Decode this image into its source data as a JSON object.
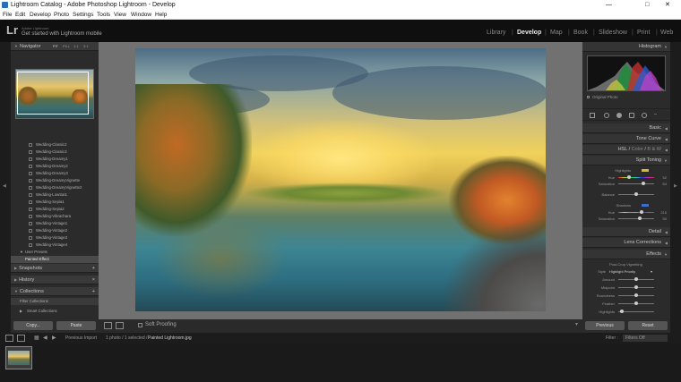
{
  "window": {
    "title": "Lightroom Catalog - Adobe Photoshop Lightroom - Develop"
  },
  "menu": [
    "File",
    "Edit",
    "Develop",
    "Photo",
    "Settings",
    "Tools",
    "View",
    "Window",
    "Help"
  ],
  "identity": {
    "logo": "Lr",
    "brand": "Adobe Lightroom",
    "mobile": "Get started with Lightroom mobile"
  },
  "modules": [
    "Library",
    "Develop",
    "Map",
    "Book",
    "Slideshow",
    "Print",
    "Web"
  ],
  "left": {
    "navigator": {
      "title": "Navigator",
      "zoom": [
        "FIT",
        "FILL",
        "1:1",
        "3:1"
      ]
    },
    "presets": [
      "Wedding-Classic2",
      "Wedding-Classic3",
      "Wedding-Dreamy1",
      "Wedding-Dreamy2",
      "Wedding-Dreamy3",
      "Wedding-DreamyVignette",
      "Wedding-DreamyVignette2",
      "Wedding-LowSat1",
      "Wedding-Sepia1",
      "Wedding-Sepia2",
      "Wedding-Vibrachara",
      "Wedding-Vintage1",
      "Wedding-Vintage2",
      "Wedding-Vintage3",
      "Wedding-Vintage4"
    ],
    "user_presets": "User Presets",
    "selected_preset": "Painted Effect",
    "snapshots": "Snapshots",
    "history": "History",
    "collections": "Collections",
    "filter_collections": "Filter Collections",
    "smart_collections": "Smart Collections",
    "copy": "Copy...",
    "paste": "Paste"
  },
  "right": {
    "histogram": "Histogram",
    "original_photo": "Original Photo",
    "basic": "Basic",
    "tone_curve": "Tone Curve",
    "hsl": "HSL",
    "color": "Color",
    "bw": "B & W",
    "split_toning": "Split Toning",
    "highlights": "Highlights",
    "hue": "Hue",
    "saturation": "Saturation",
    "balance": "Balance",
    "shadows": "Shadows",
    "hl_hue": "52",
    "hl_sat": "64",
    "sh_hue": "215",
    "sh_sat": "50",
    "detail": "Detail",
    "lens": "Lens Corrections",
    "effects": "Effects",
    "post_crop": "Post-Crop Vignetting",
    "style": "Style",
    "style_val": "Highlight Priority",
    "amount": "Amount",
    "midpoint": "Midpoint",
    "roundness": "Roundness",
    "feather": "Feather",
    "highlights2": "Highlights",
    "previous": "Previous",
    "reset": "Reset"
  },
  "toolbar": {
    "soft_proofing": "Soft Proofing"
  },
  "filmbar": {
    "source": "Previous Import",
    "count": "1 photo / 1 selected /",
    "file": "Painted Lightroom.jpg",
    "filter": "Filter :",
    "filter_val": "Filters Off"
  },
  "colors": {
    "accent": "#e8e8e8",
    "panel": "#2b2b2b",
    "highlight_swatch": "#d8b834",
    "shadow_swatch": "#3a6fd0"
  }
}
